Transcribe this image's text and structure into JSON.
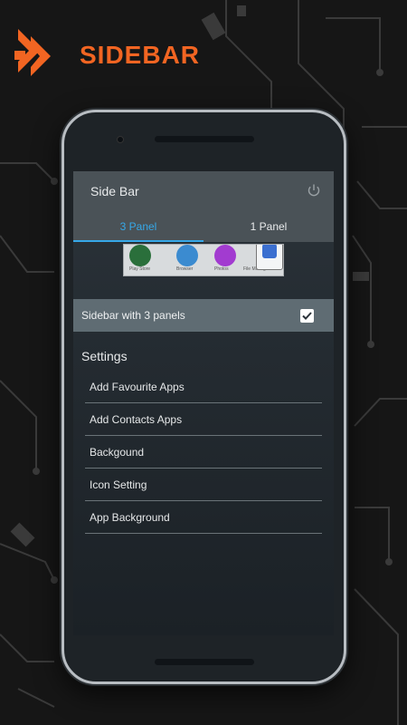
{
  "brand": {
    "title": "SIDEBAR",
    "accent_color": "#f26522",
    "logo_icon": "double-chevron-right-logo"
  },
  "app": {
    "title": "Side Bar",
    "power_icon": "power-icon",
    "tabs": [
      {
        "label": "3 Panel",
        "active": true
      },
      {
        "label": "1 Panel",
        "active": false
      }
    ],
    "accent_color": "#36a8e8",
    "preview": {
      "apps": [
        "Play Store",
        "Browser",
        "Photos",
        "File Manager"
      ]
    },
    "toggle": {
      "label": "Sidebar with 3 panels",
      "checked": true
    },
    "settings": {
      "title": "Settings",
      "items": [
        {
          "label": "Add Favourite Apps"
        },
        {
          "label": "Add Contacts Apps"
        },
        {
          "label": "Backgound"
        },
        {
          "label": "Icon Setting"
        },
        {
          "label": "App Background"
        }
      ]
    }
  }
}
